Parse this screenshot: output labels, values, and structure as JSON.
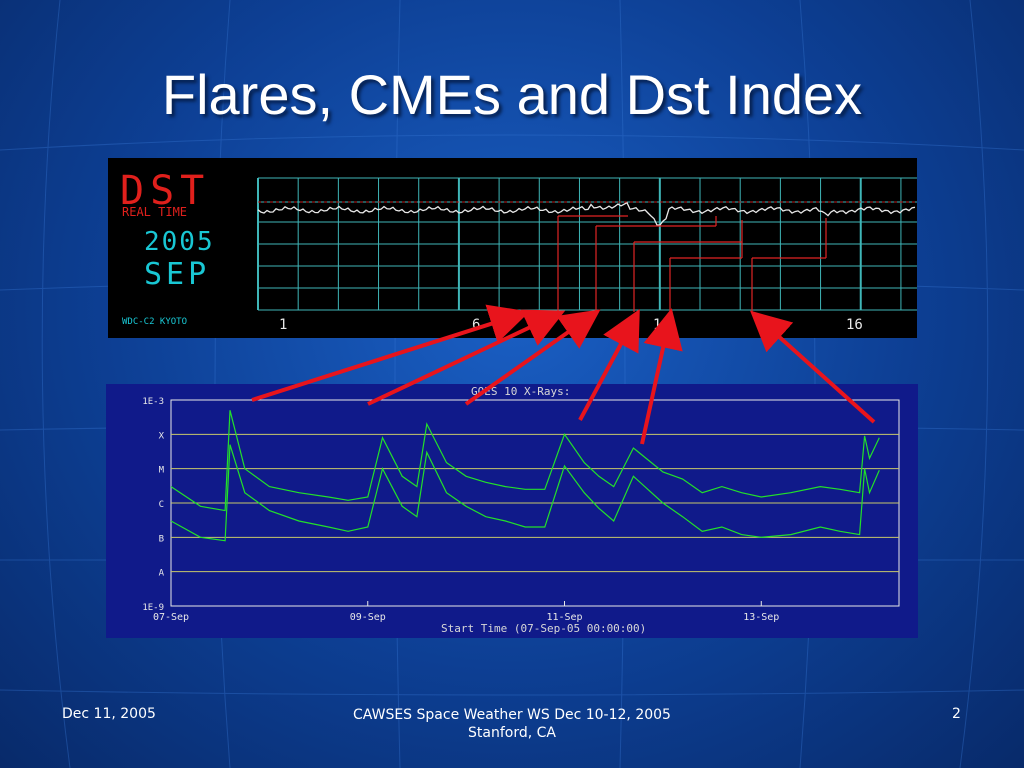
{
  "slide": {
    "title": "Flares, CMEs and Dst Index",
    "footer_date": "Dec 11, 2005",
    "footer_center": "CAWSES Space Weather WS Dec 10-12, 2005 Stanford, CA",
    "page_number": "2"
  },
  "dst": {
    "label_dst": "DST",
    "label_realtime": "REAL TIME",
    "label_year": "2005",
    "label_month": "SEP",
    "label_credit": "WDC-C2 KYOTO",
    "day_ticks": [
      "1",
      "6",
      "11",
      "16"
    ],
    "colors": {
      "title": "#e0201c",
      "year": "#19c7d4",
      "grid": "#3fb6b8",
      "trace": "#e8e8e8"
    }
  },
  "chart_data": {
    "type": "line",
    "title": "GOES 10 X-Rays:",
    "xlabel": "Start Time (07-Sep-05 00:00:00)",
    "ytick_labels": [
      "1E-3",
      "X",
      "M",
      "C",
      "B",
      "A",
      "1E-9"
    ],
    "xtick_labels": [
      "07-Sep",
      "09-Sep",
      "11-Sep",
      "13-Sep"
    ],
    "ylim": [
      1e-09,
      0.001
    ],
    "yscale": "log",
    "grid": true,
    "series": [
      {
        "x_days": [
          7.0,
          7.3,
          7.55,
          7.6,
          7.75,
          8.0,
          8.3,
          8.6,
          8.8,
          9.0,
          9.15,
          9.35,
          9.5,
          9.6,
          9.8,
          10.0,
          10.2,
          10.4,
          10.6,
          10.8,
          11.0,
          11.2,
          11.35,
          11.5,
          11.7,
          12.0,
          12.2,
          12.4,
          12.6,
          12.8,
          13.0,
          13.3,
          13.6,
          13.8,
          14.0,
          14.05,
          14.1,
          14.2
        ],
        "values": [
          3e-06,
          8e-07,
          6e-07,
          0.0005,
          1e-05,
          3e-06,
          2e-06,
          1.5e-06,
          1.2e-06,
          1.5e-06,
          8e-05,
          6e-06,
          3e-06,
          0.0002,
          1.5e-05,
          6e-06,
          4e-06,
          3e-06,
          2.5e-06,
          2.5e-06,
          0.0001,
          1.5e-05,
          6e-06,
          3e-06,
          4e-05,
          8e-06,
          5e-06,
          2e-06,
          3e-06,
          2e-06,
          1.5e-06,
          2e-06,
          3e-06,
          2.5e-06,
          2e-06,
          9e-05,
          2e-05,
          8e-05
        ],
        "color": "#22e02a"
      },
      {
        "x_days": [
          7.0,
          7.3,
          7.55,
          7.6,
          7.75,
          8.0,
          8.3,
          8.6,
          8.8,
          9.0,
          9.15,
          9.35,
          9.5,
          9.6,
          9.8,
          10.0,
          10.2,
          10.4,
          10.6,
          10.8,
          11.0,
          11.2,
          11.35,
          11.5,
          11.7,
          12.0,
          12.2,
          12.4,
          12.6,
          12.8,
          13.0,
          13.3,
          13.6,
          13.8,
          14.0,
          14.05,
          14.1,
          14.2
        ],
        "values": [
          3e-07,
          1e-07,
          8e-08,
          5e-05,
          2e-06,
          6e-07,
          3e-07,
          2e-07,
          1.5e-07,
          2e-07,
          1e-05,
          8e-07,
          4e-07,
          3e-05,
          2e-06,
          8e-07,
          4e-07,
          3e-07,
          2e-07,
          2e-07,
          1.2e-05,
          2e-06,
          7e-07,
          3e-07,
          6e-06,
          1e-06,
          4e-07,
          1.5e-07,
          2e-07,
          1.2e-07,
          1e-07,
          1.2e-07,
          2e-07,
          1.5e-07,
          1.2e-07,
          1e-05,
          2e-06,
          9e-06
        ],
        "color": "#22e02a"
      }
    ],
    "colors": {
      "background": "#101a8a",
      "grid": "#c8c86a",
      "axis": "#e8e8e8",
      "trace": "#22e02a"
    }
  },
  "annotations": {
    "arrow_color": "#e8141c",
    "connector_color": "#e02424"
  }
}
